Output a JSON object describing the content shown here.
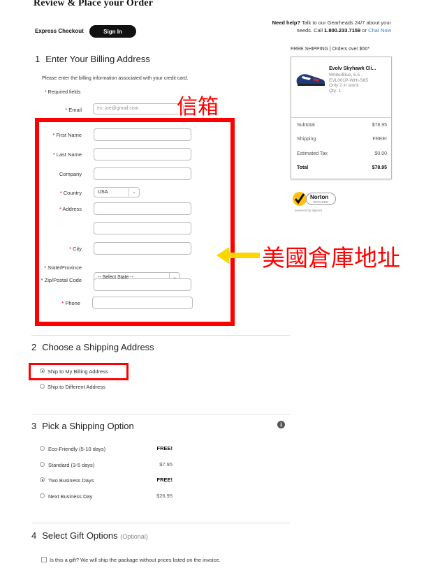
{
  "header": {
    "title": "Review & Place your Order",
    "express_checkout": "Express Checkout",
    "sign_in": "Sign In",
    "help": {
      "need_help": "Need help?",
      "text": " Talk to our Gearheads 24/7 about your needs. Call ",
      "phone": "1.800.233.7159",
      "or": " or ",
      "chat": "Chat Now"
    }
  },
  "billing": {
    "number": "1",
    "title": "Enter Your Billing Address",
    "instructions": "Please enter the billing information associated with your credit card.",
    "required_note": "Required fields",
    "email_label": "Email",
    "email_placeholder": "ex: joe@gmail.com",
    "first_name_label": "First Name",
    "last_name_label": "Last Name",
    "company_label": "Company",
    "country_label": "Country",
    "country_value": "USA",
    "address_label": "Address",
    "city_label": "City",
    "state_label": "State/Province",
    "state_value": "-- Select State --",
    "zip_label": "Zip/Postal Code",
    "phone_label": "Phone"
  },
  "annotations": {
    "email": "信箱",
    "us_warehouse_address": "美國倉庫地址"
  },
  "shipping_address": {
    "number": "2",
    "title": "Choose a Shipping Address",
    "options": [
      "Ship to My Billing Address",
      "Ship to Different Address"
    ],
    "selected": 0
  },
  "shipping_option": {
    "number": "3",
    "title": "Pick a Shipping Option",
    "options": [
      {
        "label": "Eco-Friendly (5-10 days)",
        "price": "FREE!"
      },
      {
        "label": "Standard (3-5 days)",
        "price": "$7.95"
      },
      {
        "label": "Two Business Days",
        "price": "FREE!"
      },
      {
        "label": "Next Business Day",
        "price": "$26.95"
      }
    ],
    "selected": 2
  },
  "gift": {
    "number": "4",
    "title": "Select Gift Options",
    "optional": "(Optional)",
    "checkbox_label": "Is this a gift? We will ship the package without prices listed on the invoice."
  },
  "summary": {
    "banner": "FREE SHIPPING | Orders over $50*",
    "product": {
      "name": "Evolv Skyhawk Cli...",
      "variant": "White/Blue, 6.5 -",
      "sku": "EVL001P-WHI-S65",
      "stock": "Only 2 in stock",
      "qty": "Qty: 1"
    },
    "rows": [
      {
        "label": "Subtotal",
        "value": "$78.95"
      },
      {
        "label": "Shipping",
        "value": "FREE!"
      },
      {
        "label": "Estimated Tax",
        "value": "$0.00"
      },
      {
        "label": "Total",
        "value": "$78.95"
      }
    ]
  },
  "norton": {
    "brand": "Norton",
    "secured": "SECURED",
    "powered": "powered by digicert"
  },
  "colors": {
    "annotation_red": "#ff0000",
    "annotation_arrow": "#ffd700",
    "link_blue": "#3a7fc1"
  },
  "icons": [
    "info-icon",
    "check-icon",
    "caret-down-icon",
    "arrow-left-icon",
    "shoe-image"
  ]
}
